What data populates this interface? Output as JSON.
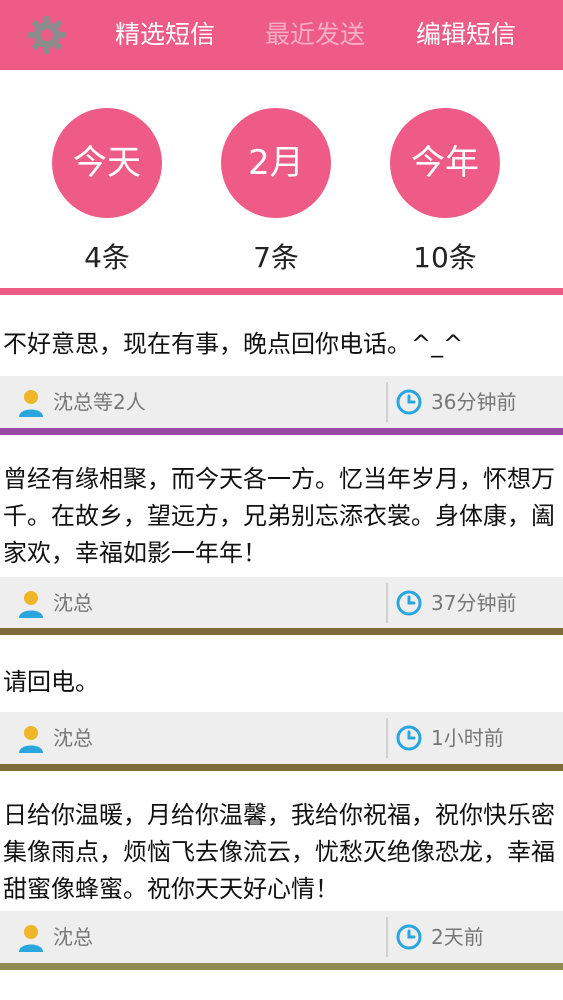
{
  "topbar": {
    "settings_icon": "gear-icon",
    "tabs": [
      {
        "label": "精选短信",
        "active": false
      },
      {
        "label": "最近发送",
        "active": true
      },
      {
        "label": "编辑短信",
        "active": false
      }
    ]
  },
  "stats": [
    {
      "label": "今天",
      "count": "4条"
    },
    {
      "label": "2月",
      "count": "7条"
    },
    {
      "label": "今年",
      "count": "10条"
    }
  ],
  "messages": [
    {
      "text": "不好意思，现在有事，晚点回你电话。^_^",
      "sender": "沈总等2人",
      "time": "36分钟前",
      "bar_color": "#9b4aa3"
    },
    {
      "text": "曾经有缘相聚，而今天各一方。忆当年岁月，怀想万千。在故乡，望远方，兄弟别忘添衣裳。身体康，阖家欢，幸福如影一年年！",
      "sender": "沈总",
      "time": "37分钟前",
      "bar_color": "#7e6a3a"
    },
    {
      "text": "请回电。",
      "sender": "沈总",
      "time": "1小时前",
      "bar_color": "#7e6a3a"
    },
    {
      "text": "日给你温暖，月给你温馨，我给你祝福，祝你快乐密集像雨点，烦恼飞去像流云，忧愁灭绝像恐龙，幸福甜蜜像蜂蜜。祝你天天好心情！",
      "sender": "沈总",
      "time": "2天前",
      "bar_color": "#8e8a52"
    }
  ],
  "colors": {
    "accent": "#ee5b87",
    "icon_blue": "#2aa6df",
    "user_icon_yellow": "#f0b62a"
  }
}
